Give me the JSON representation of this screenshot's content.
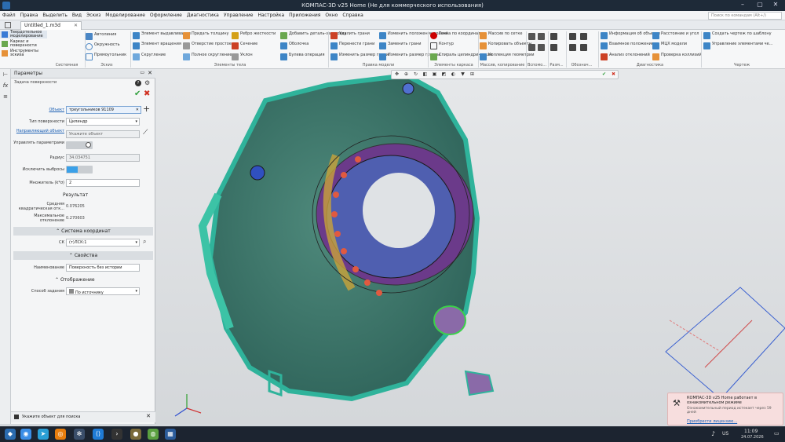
{
  "titlebar": {
    "title": "КОМПАС-3D v25 Home (Не для коммерческого использования)"
  },
  "menu": {
    "items": [
      "Файл",
      "Правка",
      "Выделить",
      "Вид",
      "Эскиз",
      "Моделирование",
      "Оформление",
      "Диагностика",
      "Управление",
      "Настройка",
      "Приложения",
      "Окно",
      "Справка"
    ],
    "search_placeholder": "Поиск по командам (Alt+/)"
  },
  "tab": {
    "label": "Untitled_1.m3d"
  },
  "ribbon": {
    "modes": [
      "Твердотельное моделирование",
      "Каркас и поверхности",
      "Инструменты эскиза"
    ],
    "groups": [
      "Системная",
      "Эскиз",
      "Элементы тела",
      "Правка модели",
      "Элементы каркаса",
      "Массив, копирование",
      "Вспомо...",
      "Разм...",
      "Обознач...",
      "Диагностика",
      "Чертеж"
    ],
    "sketch": [
      "Автолиния",
      "Окружность",
      "Прямоугольник"
    ],
    "body": [
      "Элемент выдавливания",
      "Элемент вращения",
      "Скругление",
      "Придать толщину",
      "Отверстие простое",
      "Полное скругление",
      "Ребро жесткости",
      "Сечение",
      "Уклон",
      "Добавить деталь-заготовку",
      "Оболочка",
      "Булева операция"
    ],
    "edit": [
      "Удалить грани",
      "Перенести грани",
      "Изменить размер грани",
      "Изменить положение граней",
      "Заменить грани",
      "Изменить размер группы"
    ],
    "frame": [
      "Точка по координатам",
      "Контур",
      "Спираль цилиндрическая"
    ],
    "array": [
      "Массив по сетке",
      "Копировать объекты",
      "Коллекция геометрии"
    ],
    "diag": [
      "Информация об объекте",
      "Взаимное положение",
      "Анализ отклонений",
      "Расстояние и угол",
      "МЦХ модели",
      "Проверка коллизий"
    ],
    "drawing": [
      "Создать чертеж по шаблону",
      "Управление элементами че..."
    ]
  },
  "panel": {
    "title": "Параметры",
    "subtitle": "Задача поверхности",
    "object_label": "Объект",
    "object_value": "треугольников 91109",
    "type_label": "Тип поверхности",
    "type_value": "Цилиндр",
    "direction_label": "Направляющий объект",
    "direction_placeholder": "Укажите объект",
    "manage_label": "Управлять параметрами",
    "radius_label": "Радиус",
    "radius_value": "34.034751",
    "exclude_label": "Исключить выбросы",
    "multiplier_label": "Множитель (k*σ)",
    "multiplier_value": "2",
    "result_label": "Результат",
    "mean_label": "Средняя квадратическая отк...",
    "mean_value": "0.076205",
    "max_label": "Максимальное отклонение",
    "max_value": "0.270603",
    "section_coords": "Система координат",
    "cs_label": "СК",
    "cs_value": "(т)ЛСК:1",
    "section_props": "Свойства",
    "name_label": "Наименование",
    "name_value": "Поверхность без истории",
    "section_display": "Отображение",
    "method_label": "Способ задания",
    "method_value": "По источнику",
    "status_text": "Укажите объект для поиска"
  },
  "notification": {
    "title": "КОМПАС-3D v25 Home работает в ознакомительном режиме",
    "body": "Ознакомительный период истекает через 59 дней",
    "link": "Приобрести лицензию..."
  },
  "taskbar": {
    "lang": "US",
    "time": "11:09",
    "date": "24.07.2026"
  },
  "colors": {
    "mesh": "#2fa08a",
    "accent": "#1a5fb4",
    "ring": "#e05a40"
  }
}
